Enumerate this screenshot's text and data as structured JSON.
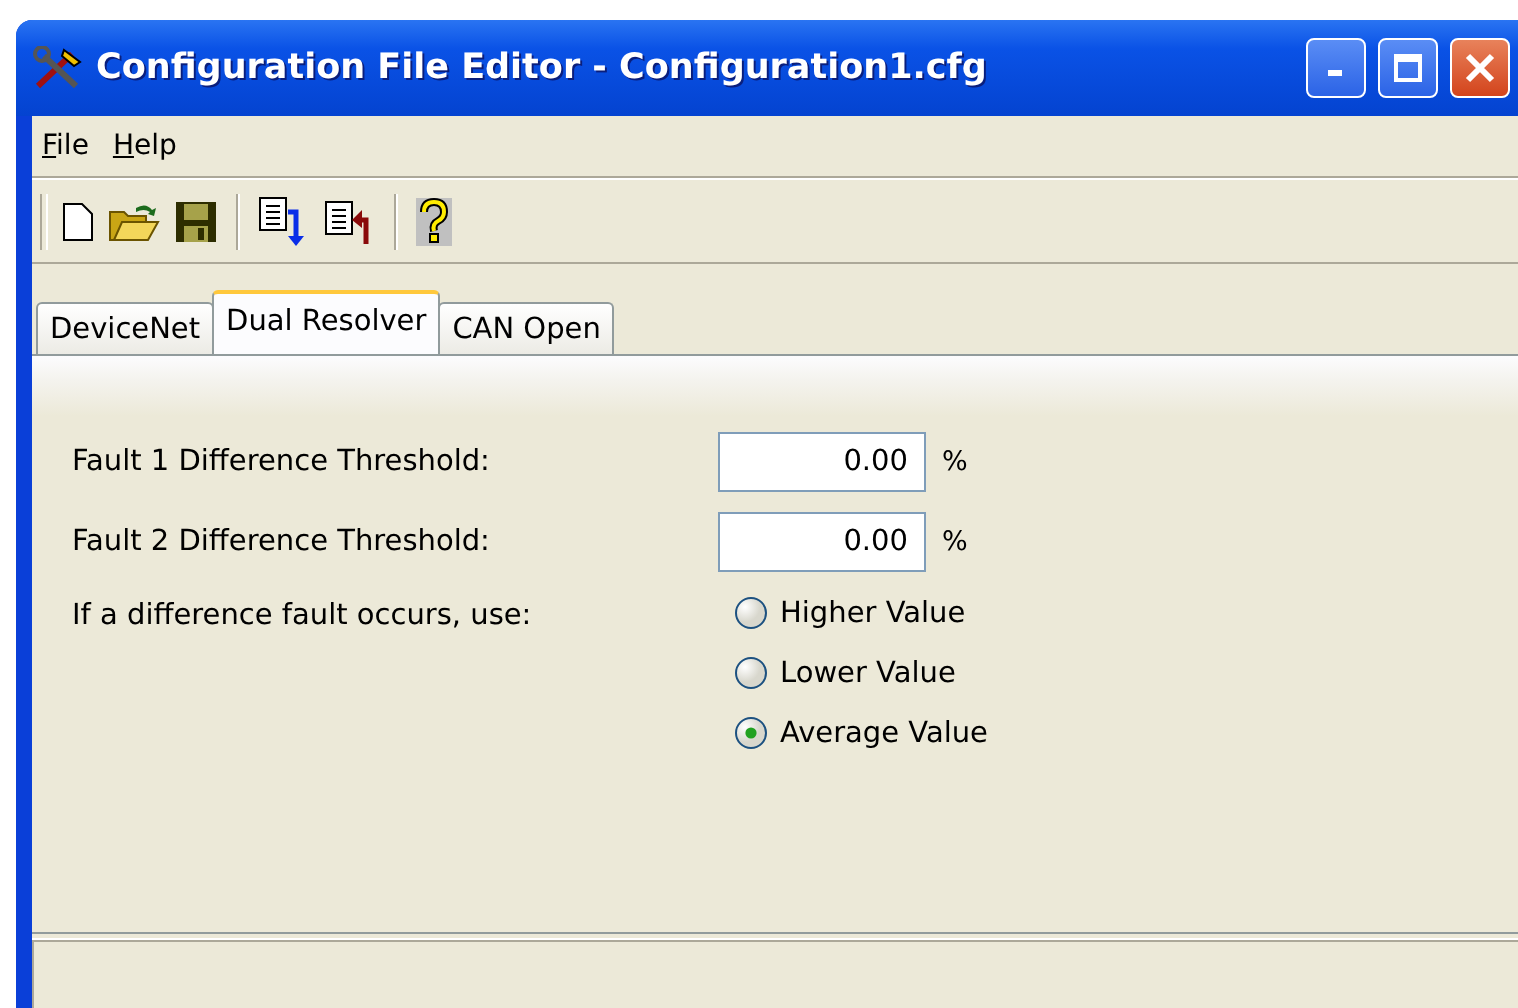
{
  "window": {
    "title": "Configuration File Editor - Configuration1.cfg"
  },
  "menu": [
    {
      "label": "File",
      "first_letter_underlined": true
    },
    {
      "label": "Help",
      "first_letter_underlined": true
    }
  ],
  "toolbar": [
    {
      "kind": "new"
    },
    {
      "kind": "open"
    },
    {
      "kind": "save"
    },
    {
      "kind": "separator"
    },
    {
      "kind": "import"
    },
    {
      "kind": "export"
    },
    {
      "kind": "separator"
    },
    {
      "kind": "help"
    }
  ],
  "tabs": [
    {
      "label": "DeviceNet",
      "selected": false
    },
    {
      "label": "Dual Resolver",
      "selected": true
    },
    {
      "label": "CAN Open",
      "selected": false
    }
  ],
  "fields": [
    {
      "label": "Fault 1 Difference Threshold:",
      "value": "0.00",
      "unit": "%"
    },
    {
      "label": "Fault 2 Difference Threshold:",
      "value": "0.00",
      "unit": "%"
    }
  ],
  "fault_choice": {
    "label": "If a difference fault occurs, use:",
    "options": [
      {
        "label": "Higher Value",
        "selected": false
      },
      {
        "label": "Lower Value",
        "selected": false
      },
      {
        "label": "Average Value",
        "selected": true
      }
    ]
  }
}
